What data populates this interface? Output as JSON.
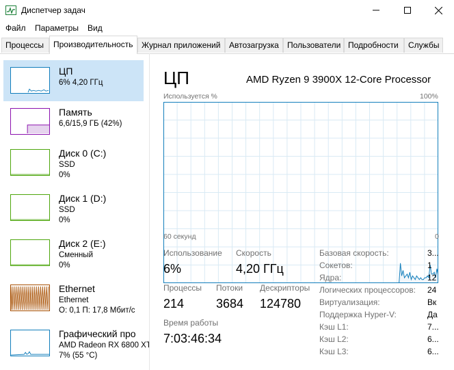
{
  "window": {
    "title": "Диспетчер задач",
    "icon": "task-manager-icon"
  },
  "menu": {
    "file": "Файл",
    "options": "Параметры",
    "view": "Вид"
  },
  "tabs": [
    "Процессы",
    "Производительность",
    "Журнал приложений",
    "Автозагрузка",
    "Пользователи",
    "Подробности",
    "Службы"
  ],
  "sidebar": {
    "cpu": {
      "title": "ЦП",
      "sub1": "6% 4,20 ГГц"
    },
    "memory": {
      "title": "Память",
      "sub1": "6,6/15,9 ГБ (42%)"
    },
    "disk0": {
      "title": "Диск 0 (C:)",
      "sub1": "SSD",
      "sub2": "0%"
    },
    "disk1": {
      "title": "Диск 1 (D:)",
      "sub1": "SSD",
      "sub2": "0%"
    },
    "disk2": {
      "title": "Диск 2 (E:)",
      "sub1": "Сменный",
      "sub2": "0%"
    },
    "ethernet": {
      "title": "Ethernet",
      "sub1": "Ethernet",
      "sub2": "О: 0,1 П: 17,8 Мбит/с"
    },
    "gpu": {
      "title": "Графический про",
      "sub1": "AMD Radeon RX 6800 XT",
      "sub2": "7% (55 °C)"
    }
  },
  "main": {
    "title": "ЦП",
    "processor": "AMD Ryzen 9 3900X 12-Core Processor",
    "graph_label": "Используется %",
    "graph_max": "100%",
    "time_label": "60 секунд",
    "zero_label": "0"
  },
  "stats": {
    "usage_label": "Использование",
    "usage_value": "6%",
    "speed_label": "Скорость",
    "speed_value": "4,20 ГГц",
    "processes_label": "Процессы",
    "processes_value": "214",
    "threads_label": "Потоки",
    "threads_value": "3684",
    "handles_label": "Дескрипторы",
    "handles_value": "124780",
    "uptime_label": "Время работы",
    "uptime_value": "7:03:46:34"
  },
  "details": [
    {
      "key": "Базовая скорость:",
      "value": "3..."
    },
    {
      "key": "Сокетов:",
      "value": "1"
    },
    {
      "key": "Ядра:",
      "value": "12"
    },
    {
      "key": "Логических процессоров:",
      "value": "24"
    },
    {
      "key": "Виртуализация:",
      "value": "Вк"
    },
    {
      "key": "Поддержка Hyper-V:",
      "value": "Да"
    },
    {
      "key": "Кэш L1:",
      "value": "7..."
    },
    {
      "key": "Кэш L2:",
      "value": "6..."
    },
    {
      "key": "Кэш L3:",
      "value": "6..."
    }
  ],
  "colors": {
    "cpu": "#117dbb",
    "memory": "#8b12ae",
    "disk": "#4da60c",
    "ethernet": "#a74f01",
    "selected": "#cce4f7"
  },
  "cpu_history": [
    0,
    0,
    0,
    0,
    0,
    0,
    0,
    0,
    0,
    0,
    0,
    0,
    0,
    0,
    0,
    0,
    0,
    0,
    0,
    0,
    0,
    0,
    0,
    0,
    0,
    0,
    0,
    0,
    0,
    0,
    0,
    0,
    0,
    0,
    0,
    0,
    0,
    0,
    0,
    0,
    0,
    0,
    0,
    0,
    0,
    0,
    0,
    0,
    0,
    0,
    0,
    0,
    0,
    0,
    0,
    0,
    0,
    0,
    0,
    0,
    0,
    0,
    0,
    0,
    0,
    0,
    0,
    0,
    0,
    0,
    0,
    0,
    0,
    0,
    0,
    0,
    0,
    0,
    0,
    0,
    0,
    0,
    0,
    0,
    0,
    0,
    0,
    0,
    0,
    0,
    0,
    0,
    0,
    0,
    0,
    0,
    0,
    0,
    0,
    0,
    0,
    0,
    0,
    0,
    0,
    0,
    0,
    0,
    0,
    0,
    0,
    0,
    0,
    0,
    0,
    0,
    0,
    0,
    0,
    0,
    0,
    0,
    0,
    0,
    0,
    0,
    0,
    0,
    0,
    0,
    0,
    0,
    0,
    0,
    0,
    0,
    0,
    0,
    0,
    0,
    0,
    0,
    0,
    0,
    0,
    0,
    0,
    0,
    0,
    0,
    0,
    0,
    0,
    0,
    0,
    0,
    0,
    0,
    0,
    0,
    0,
    0,
    0,
    0,
    0,
    0,
    0,
    0,
    0,
    0,
    0,
    0,
    0,
    0,
    0,
    11,
    4,
    7,
    3,
    4,
    5,
    3,
    6,
    2,
    4,
    3,
    2,
    4,
    3,
    2,
    3,
    2,
    2,
    3,
    3,
    4,
    3,
    10,
    5,
    5,
    6,
    3,
    8,
    4
  ]
}
